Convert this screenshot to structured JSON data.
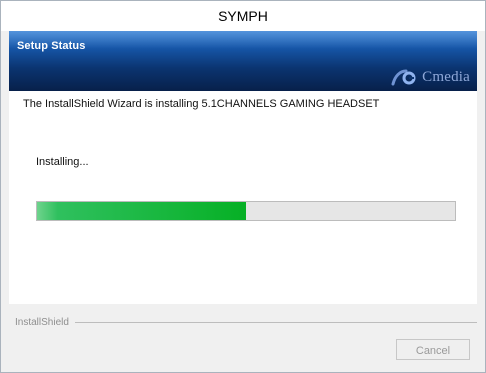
{
  "window": {
    "title": "SYMPH"
  },
  "banner": {
    "title": "Setup Status",
    "logo_text": "Cmedia",
    "logo_icon": "cmedia-swirl-icon"
  },
  "status": {
    "message": "The InstallShield Wizard is installing 5.1CHANNELS GAMING HEADSET",
    "action": "Installing..."
  },
  "progress": {
    "fraction": 0.5,
    "color": "#06b025"
  },
  "footer": {
    "brand": "InstallShield",
    "cancel_label": "Cancel"
  },
  "colors": {
    "banner_dark": "#07204a",
    "banner_light": "#2f7cd4",
    "progress_fill": "#06b025"
  }
}
